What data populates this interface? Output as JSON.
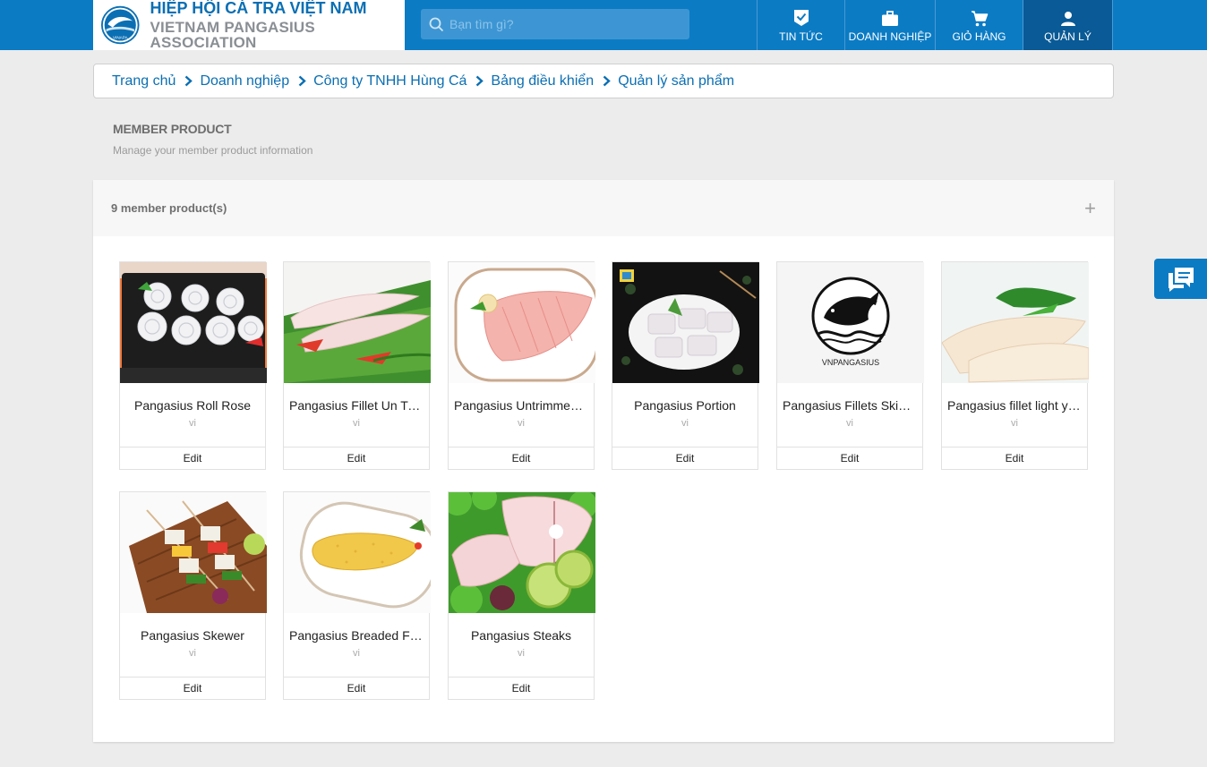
{
  "header": {
    "logo_vn": "HIỆP HỘI CÁ TRA VIỆT NAM",
    "logo_en": "VIETNAM PANGASIUS ASSOCIATION",
    "logo_badge": "VINAPA",
    "search_placeholder": "Bạn tìm gì?",
    "nav": [
      {
        "label": "TIN TỨC",
        "icon": "news-check-icon"
      },
      {
        "label": "DOANH NGHIỆP",
        "icon": "briefcase-icon"
      },
      {
        "label": "GIỎ HÀNG",
        "icon": "cart-icon"
      },
      {
        "label": "QUẢN LÝ",
        "icon": "user-icon",
        "active": true
      }
    ]
  },
  "breadcrumb": [
    "Trang chủ",
    "Doanh nghiệp",
    "Công ty TNHH Hùng Cá",
    "Bảng điều khiển",
    "Quản lý sản phẩm"
  ],
  "section": {
    "title": "MEMBER PRODUCT",
    "subtitle": "Manage your member product information"
  },
  "panel": {
    "count_label": "9 member product(s)",
    "add_symbol": "+"
  },
  "products": [
    {
      "name": "Pangasius Roll Rose",
      "lang": "vi",
      "edit": "Edit"
    },
    {
      "name": "Pangasius Fillet Un Trimmed",
      "lang": "vi",
      "edit": "Edit"
    },
    {
      "name": "Pangasius Untrimmed Fillet",
      "lang": "vi",
      "edit": "Edit"
    },
    {
      "name": "Pangasius Portion",
      "lang": "vi",
      "edit": "Edit"
    },
    {
      "name": "Pangasius Fillets Skinless",
      "lang": "vi",
      "edit": "Edit"
    },
    {
      "name": "Pangasius fillet light yellow",
      "lang": "vi",
      "edit": "Edit"
    },
    {
      "name": "Pangasius Skewer",
      "lang": "vi",
      "edit": "Edit"
    },
    {
      "name": "Pangasius Breaded Fillet",
      "lang": "vi",
      "edit": "Edit"
    },
    {
      "name": "Pangasius Steaks",
      "lang": "vi",
      "edit": "Edit"
    }
  ],
  "logo_card_text": "VNPANGASIUS",
  "colors": {
    "primary": "#0b7bc4",
    "active_nav": "#095a96",
    "link": "#0b6fb3"
  }
}
